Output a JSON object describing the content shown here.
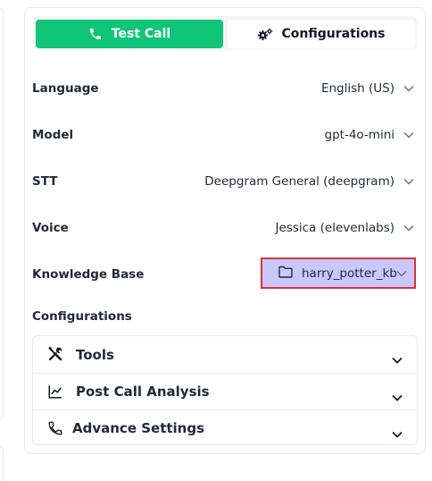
{
  "tabs": {
    "test_call": "Test Call",
    "configurations": "Configurations"
  },
  "fields": [
    {
      "label": "Language",
      "value": "English (US)"
    },
    {
      "label": "Model",
      "value": "gpt-4o-mini"
    },
    {
      "label": "STT",
      "value": "Deepgram General (deepgram)"
    },
    {
      "label": "Voice",
      "value": "Jessica (elevenlabs)"
    },
    {
      "label": "Knowledge Base",
      "value": "harry_potter_kb"
    }
  ],
  "section": {
    "configurations_label": "Configurations"
  },
  "accordion": [
    {
      "label": "Tools",
      "icon": "tools-icon"
    },
    {
      "label": "Post Call Analysis",
      "icon": "line-chart-icon"
    },
    {
      "label": "Advance Settings",
      "icon": "phone-icon"
    }
  ],
  "colors": {
    "accent_green": "#10c578",
    "kb_highlight": "#c9c7fb",
    "kb_outline": "#d7333e"
  }
}
